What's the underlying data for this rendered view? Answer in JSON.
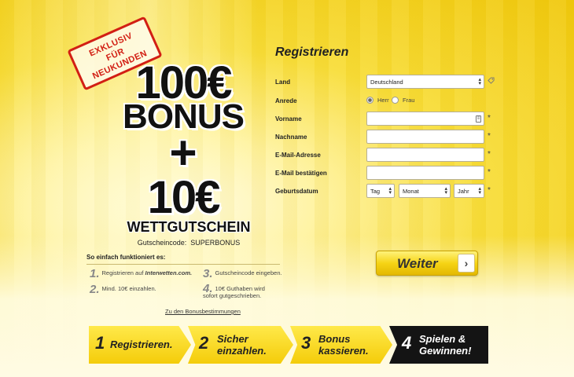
{
  "promo": {
    "stamp_line1": "EXKLUSIV",
    "stamp_line2": "FÜR",
    "stamp_line3": "NEUKUNDEN",
    "amount": "100€",
    "bonus": "BONUS",
    "plus": "+",
    "voucher_amount": "10€",
    "voucher_word": "WETTGUTSCHEIN",
    "code_label": "Gutscheincode:",
    "code_value": "SUPERBONUS"
  },
  "howto": {
    "title": "So einfach funktioniert es:",
    "steps": [
      {
        "num": "1.",
        "text": "Registrieren auf ",
        "brand": "Interwetten.com."
      },
      {
        "num": "2.",
        "text": "Mind. 10€ einzahlen."
      },
      {
        "num": "3.",
        "text": "Gutscheincode eingeben."
      },
      {
        "num": "4.",
        "text": "10€ Guthaben wird sofort gutgeschrieben."
      }
    ],
    "terms_link": "Zu den Bonusbestimmungen"
  },
  "form": {
    "title": "Registrieren",
    "land_label": "Land",
    "land_value": "Deutschland",
    "anrede_label": "Anrede",
    "anrede_options": [
      "Herr",
      "Frau"
    ],
    "anrede_selected": "Herr",
    "vorname_label": "Vorname",
    "nachname_label": "Nachname",
    "email_label": "E-Mail-Adresse",
    "email_confirm_label": "E-Mail bestätigen",
    "geburtsdatum_label": "Geburtsdatum",
    "day_value": "Tag",
    "month_value": "Monat",
    "year_value": "Jahr",
    "required_mark": "*",
    "submit_label": "Weiter",
    "submit_arrow": "›"
  },
  "banner": {
    "steps": [
      {
        "num": "1",
        "label": "Registrieren."
      },
      {
        "num": "2",
        "label_line1": "Sicher",
        "label_line2": "einzahlen."
      },
      {
        "num": "3",
        "label_line1": "Bonus",
        "label_line2": "kassieren."
      },
      {
        "num": "4",
        "label_line1": "Spielen &",
        "label_line2": "Gewinnen!"
      }
    ]
  },
  "icons": {
    "country_icon": "tag-icon",
    "card_icon": "id-card-icon"
  },
  "colors": {
    "stamp_red": "#d21f14",
    "brand_yellow": "#f4cc0a",
    "final_step_black": "#141414"
  }
}
